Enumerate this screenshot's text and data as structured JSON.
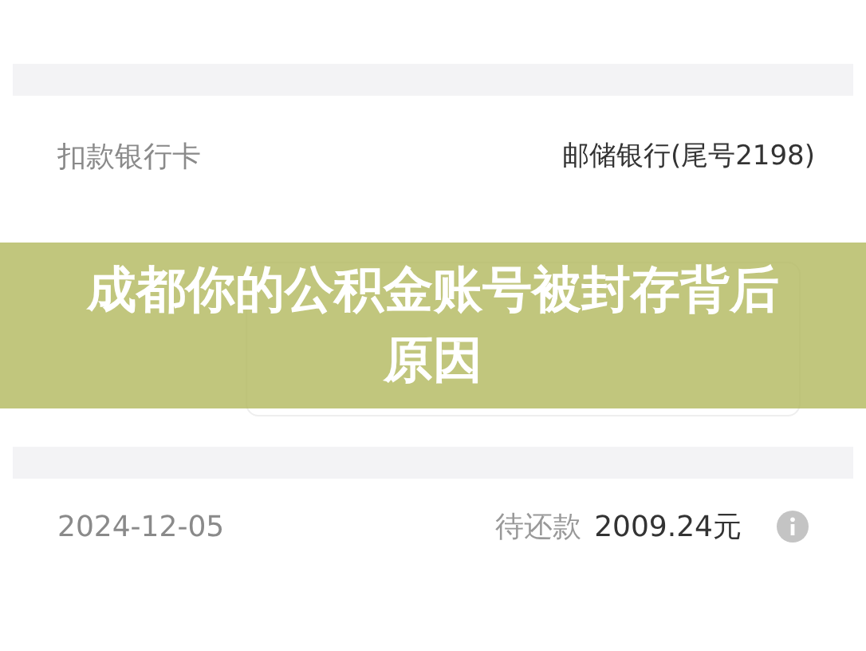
{
  "bank_row": {
    "label": "扣款银行卡",
    "value": "邮储银行(尾号2198)"
  },
  "schedule": [
    {
      "date": "2024-12-05",
      "status": "待还款",
      "amount": "2009.24元"
    }
  ],
  "banner": {
    "title": "成都你的公积金账号被封存背后原因"
  }
}
